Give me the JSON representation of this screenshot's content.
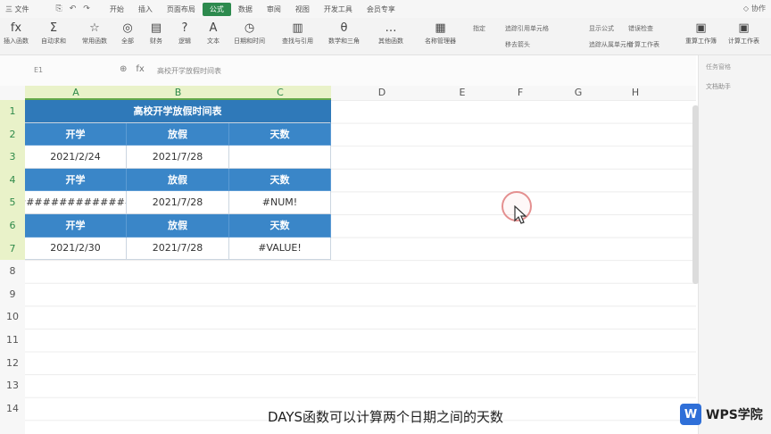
{
  "menubar": {
    "file_label": "三 文件",
    "quick_icons": [
      "⎘",
      "↶",
      "↷"
    ],
    "tabs": [
      "开始",
      "插入",
      "页面布局",
      "公式",
      "数据",
      "审阅",
      "视图",
      "开发工具",
      "会员专享"
    ],
    "active_tab_index": 3,
    "right_label": "协作"
  },
  "ribbon": {
    "buttons": [
      {
        "icon": "fx",
        "label": "插入函数"
      },
      {
        "icon": "Σ",
        "label": "自动求和"
      },
      {
        "icon": "☆",
        "label": "常用函数"
      },
      {
        "icon": "◎",
        "label": "全部"
      },
      {
        "icon": "▤",
        "label": "财务"
      },
      {
        "icon": "?",
        "label": "逻辑"
      },
      {
        "icon": "A",
        "label": "文本"
      },
      {
        "icon": "◷",
        "label": "日期和时间"
      },
      {
        "icon": "▥",
        "label": "查找与引用"
      },
      {
        "icon": "θ",
        "label": "数学和三角"
      },
      {
        "icon": "…",
        "label": "其他函数"
      },
      {
        "icon": "▦",
        "label": "名称管理器"
      }
    ],
    "small_items": [
      "指定",
      "追踪引用单元格",
      "移去箭头",
      "显示公式",
      "追踪从属单元格",
      "错误检查",
      "计算工作表"
    ],
    "right_buttons": [
      "重算工作簿",
      "计算工作表"
    ]
  },
  "formula_bar": {
    "name_box": "E1",
    "formula_text": "高校开学放假时间表"
  },
  "right_panel": {
    "title": "任务窗格",
    "item": "文档助手"
  },
  "columns": [
    "A",
    "B",
    "C",
    "D",
    "E",
    "F",
    "G",
    "H"
  ],
  "rows": [
    "1",
    "2",
    "3",
    "4",
    "5",
    "6",
    "7",
    "8",
    "9",
    "10",
    "11",
    "12",
    "13",
    "14"
  ],
  "table": {
    "title": "高校开学放假时间表",
    "rows": [
      {
        "kind": "head",
        "cells": [
          "开学",
          "放假",
          "天数"
        ]
      },
      {
        "kind": "val",
        "cells": [
          "2021/2/24",
          "2021/7/28",
          ""
        ]
      },
      {
        "kind": "head",
        "cells": [
          "开学",
          "放假",
          "天数"
        ]
      },
      {
        "kind": "val",
        "cells": [
          "##############",
          "2021/7/28",
          "#NUM!"
        ]
      },
      {
        "kind": "head",
        "cells": [
          "开学",
          "放假",
          "天数"
        ]
      },
      {
        "kind": "val",
        "cells": [
          "2021/2/30",
          "2021/7/28",
          "#VALUE!"
        ]
      }
    ]
  },
  "subtitle": "DAYS函数可以计算两个日期之间的天数",
  "brand": {
    "logo_letter": "W",
    "name": "WPS学院"
  },
  "colors": {
    "header_blue": "#3a86c8",
    "title_blue": "#2f79b9",
    "accent_green": "#2d8a4e",
    "brand_blue": "#2f6fd8"
  }
}
